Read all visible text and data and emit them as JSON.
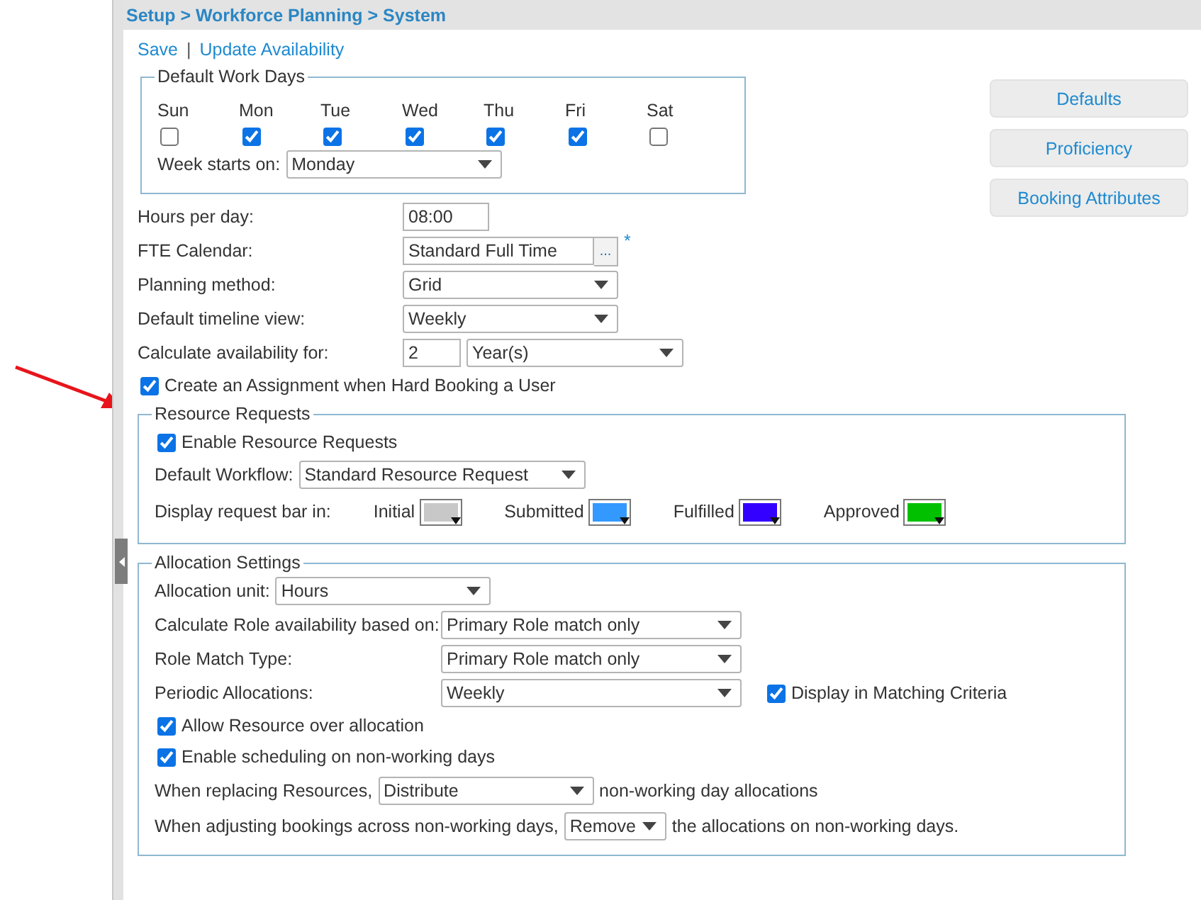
{
  "breadcrumb": "Setup > Workforce Planning > System",
  "actions": [
    {
      "label": "Save"
    },
    {
      "label": "Update Availability"
    }
  ],
  "action_separator": "|",
  "work_days": {
    "legend": "Default Work Days",
    "days": [
      {
        "label": "Sun",
        "checked": false
      },
      {
        "label": "Mon",
        "checked": true
      },
      {
        "label": "Tue",
        "checked": true
      },
      {
        "label": "Wed",
        "checked": true
      },
      {
        "label": "Thu",
        "checked": true
      },
      {
        "label": "Fri",
        "checked": true
      },
      {
        "label": "Sat",
        "checked": false
      }
    ],
    "week_start": {
      "label": "Week starts on:",
      "value": "Monday"
    }
  },
  "side_buttons": [
    {
      "label": "Defaults"
    },
    {
      "label": "Proficiency"
    },
    {
      "label": "Booking Attributes"
    }
  ],
  "form_rows": [
    {
      "kind": "input",
      "label": "Hours per day:",
      "value": "08:00"
    },
    {
      "kind": "lookup",
      "label": "FTE Calendar:",
      "value": "Standard Full Time",
      "button": "...",
      "required_mark": "*"
    },
    {
      "kind": "select",
      "label": "Planning method:",
      "value": "Grid"
    },
    {
      "kind": "select",
      "label": "Default timeline view:",
      "value": "Weekly"
    },
    {
      "kind": "input_select",
      "label": "Calculate availability for:",
      "value": "2",
      "unit": "Year(s)"
    }
  ],
  "assignment_checkbox": {
    "label": "Create an Assignment when Hard Booking a User",
    "checked": true
  },
  "resource_requests": {
    "legend": "Resource Requests",
    "enable": {
      "label": "Enable Resource Requests",
      "checked": true
    },
    "workflow": {
      "label": "Default Workflow:",
      "value": "Standard Resource Request"
    },
    "bar_colors": {
      "label": "Display request bar in:",
      "items": [
        {
          "label": "Initial",
          "color": "#c8c8c8"
        },
        {
          "label": "Submitted",
          "color": "#3399ff"
        },
        {
          "label": "Fulfilled",
          "color": "#3300ff"
        },
        {
          "label": "Approved",
          "color": "#00c000"
        }
      ]
    }
  },
  "allocation": {
    "legend": "Allocation Settings",
    "rows": [
      {
        "kind": "inline_select",
        "label": "Allocation unit:",
        "value": "Hours"
      },
      {
        "kind": "select",
        "label": "Calculate Role availability based on:",
        "value": "Primary Role match only"
      },
      {
        "kind": "select",
        "label": "Role Match Type:",
        "value": "Primary Role match only"
      },
      {
        "kind": "select",
        "label": "Periodic Allocations:",
        "value": "Weekly",
        "extra": {
          "label": "Display in Matching Criteria",
          "checked": true
        }
      },
      {
        "kind": "checkbox",
        "label": "Allow Resource over allocation",
        "checked": true
      },
      {
        "kind": "checkbox",
        "label": "Enable scheduling on non-working days",
        "checked": true
      },
      {
        "kind": "sentence",
        "before": "When replacing Resources,",
        "value": "Distribute",
        "after": "non-working day allocations"
      },
      {
        "kind": "sentence",
        "before": "When adjusting bookings across non-working days,",
        "value": "Remove",
        "after": "the allocations on non-working days."
      }
    ]
  }
}
